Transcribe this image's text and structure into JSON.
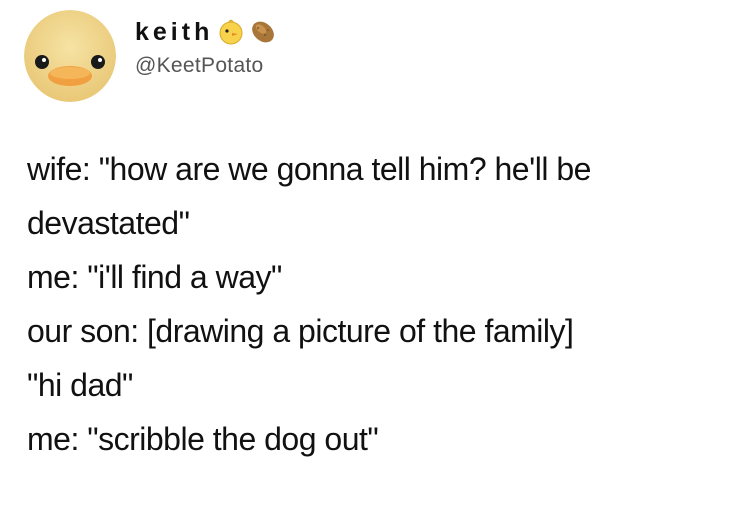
{
  "author": {
    "display_name": "keith",
    "handle": "@KeetPotato",
    "name_emojis": [
      "chick-icon",
      "potato-icon"
    ]
  },
  "tweet": {
    "lines": [
      "wife: \"how are we gonna tell him? he'll be",
      "devastated\"",
      "me: \"i'll find a way\"",
      "our son: [drawing a picture of the family]",
      "\"hi dad\"",
      "me: \"scribble the dog out\""
    ]
  },
  "colors": {
    "background": "#ffffff",
    "text": "#111111",
    "handle": "#555555",
    "avatar_yellow": "#f2d98a",
    "beak_orange": "#f0a040"
  }
}
